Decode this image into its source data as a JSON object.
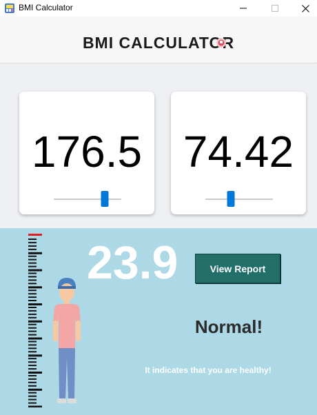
{
  "window": {
    "title": "BMI Calculator",
    "icon": "bmi-app-icon"
  },
  "header": {
    "title": "BMI CALCULATOR"
  },
  "height_card": {
    "value": "176.5",
    "slider_fraction": 0.76
  },
  "weight_card": {
    "value": "74.42",
    "slider_fraction": 0.38
  },
  "result": {
    "bmi": "23.9",
    "view_report_label": "View Report",
    "status": "Normal!",
    "description": "It indicates that you are healthy!"
  },
  "colors": {
    "accent_blue": "#0078d7",
    "result_background": "#add8e6",
    "button_teal": "#216f68",
    "ruler_marker_red": "#e41b23"
  }
}
